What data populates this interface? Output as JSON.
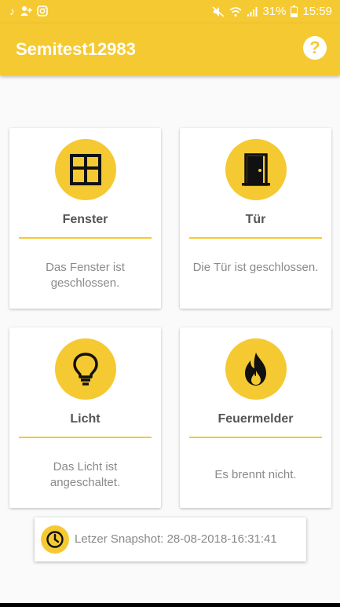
{
  "status_bar": {
    "left_icons": [
      "tiktok-icon",
      "add-person-icon",
      "instagram-icon"
    ],
    "right_icons": [
      "mute-icon",
      "wifi-icon",
      "signal-icon",
      "battery-icon"
    ],
    "battery": "31%",
    "time": "15:59"
  },
  "appbar": {
    "title": "Semitest12983",
    "help_label": "?"
  },
  "cards": [
    {
      "icon": "window-icon",
      "title": "Fenster",
      "desc": "Das Fenster ist geschlossen."
    },
    {
      "icon": "door-icon",
      "title": "Tür",
      "desc": "Die Tür ist geschlossen."
    },
    {
      "icon": "lightbulb-icon",
      "title": "Licht",
      "desc": "Das Licht ist angeschaltet."
    },
    {
      "icon": "fire-icon",
      "title": "Feuermelder",
      "desc": "Es brennt nicht."
    }
  ],
  "snapshot": {
    "icon": "clock-icon",
    "text": "Letzer Snapshot: 28-08-2018-16:31:41"
  },
  "colors": {
    "accent": "#f5c932",
    "title_text": "#555555",
    "body_text": "#8a8a8a"
  }
}
